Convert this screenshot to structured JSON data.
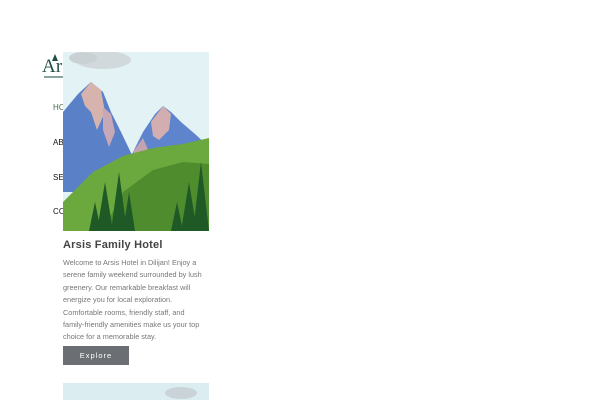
{
  "brand": {
    "name": "Arsis"
  },
  "nav": {
    "items": [
      {
        "label": "HOME",
        "active": true
      },
      {
        "label": "ABOUT",
        "active": false
      },
      {
        "label": "SERVICES",
        "active": false
      },
      {
        "label": "CONTACT",
        "active": false
      }
    ]
  },
  "card": {
    "title": "Arsis Family Hotel",
    "description": "Welcome to Arsis Hotel in Dilijan! Enjoy a serene family weekend surrounded by lush greenery. Our remarkable breakfast will energize you for local exploration. Comfortable rooms, friendly staff, and family-friendly amenities make us your top choice for a memorable stay.",
    "button_label": "Explore"
  },
  "colors": {
    "brand_green": "#1f4f45",
    "active_nav": "#3e6b47",
    "button_bg": "#6b6e73"
  }
}
